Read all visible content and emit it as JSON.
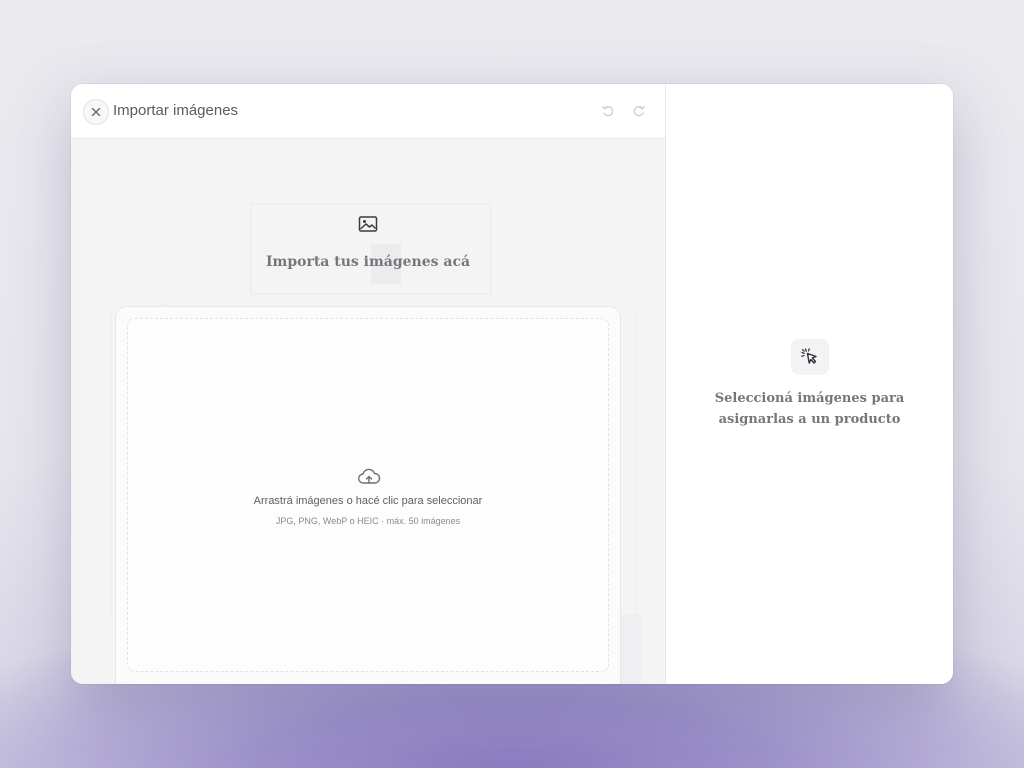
{
  "header": {
    "title": "Importar imágenes",
    "close_icon": "close-icon",
    "undo_icon": "undo-icon",
    "redo_icon": "redo-icon"
  },
  "import": {
    "icon": "image-icon",
    "heading": "Importa tus imágenes acá"
  },
  "dropzone": {
    "icon": "cloud-upload-icon",
    "text": "Arrastrá imágenes o hacé clic para seleccionar",
    "subtext": "JPG, PNG, WebP o HEIC · máx. 50 imágenes"
  },
  "sidebar": {
    "icon": "cursor-click-icon",
    "line1": "Seleccioná imágenes para",
    "line2": "asignarlas a un producto"
  },
  "colors": {
    "accent_bg": "#8a7cc0",
    "pane_bg": "#f4f4f5",
    "text_muted": "#76767b"
  }
}
